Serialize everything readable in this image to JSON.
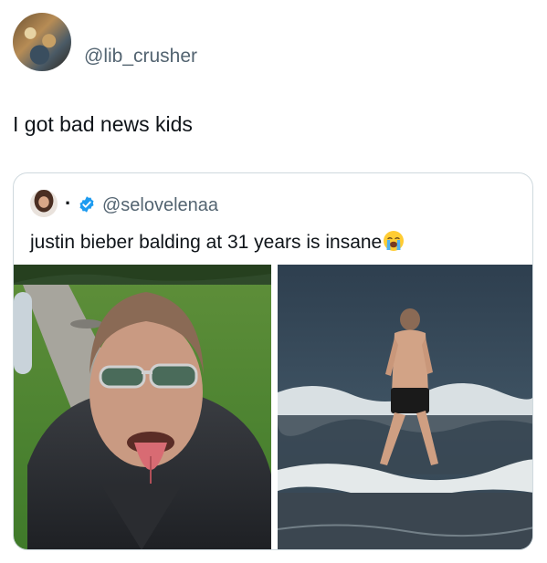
{
  "tweet": {
    "handle": "@lib_crusher",
    "text": "I got bad news kids"
  },
  "quote": {
    "name": ".",
    "handle": "@selovelenaa",
    "text": "justin bieber balding at 31 years is insane",
    "emoji": "loudly-crying-face"
  },
  "colors": {
    "handle_gray": "#536471",
    "verified_blue": "#1d9bf0",
    "border": "#cfd9de"
  }
}
